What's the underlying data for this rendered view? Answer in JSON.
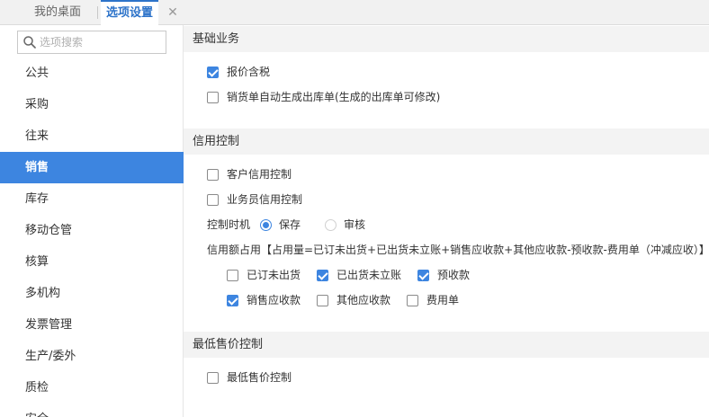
{
  "tabs": [
    {
      "label": "我的桌面"
    },
    {
      "label": "选项设置"
    }
  ],
  "tab_close_icon": "close-icon",
  "search": {
    "placeholder": "选项搜索",
    "value": ""
  },
  "sidebar": {
    "items": [
      {
        "label": "公共",
        "active": false
      },
      {
        "label": "采购",
        "active": false
      },
      {
        "label": "往来",
        "active": false
      },
      {
        "label": "销售",
        "active": true
      },
      {
        "label": "库存",
        "active": false
      },
      {
        "label": "移动仓管",
        "active": false
      },
      {
        "label": "核算",
        "active": false
      },
      {
        "label": "多机构",
        "active": false
      },
      {
        "label": "发票管理",
        "active": false
      },
      {
        "label": "生产/委外",
        "active": false
      },
      {
        "label": "质检",
        "active": false
      },
      {
        "label": "安全",
        "active": false
      }
    ]
  },
  "sections": {
    "basic": {
      "title": "基础业务",
      "options": [
        {
          "label": "报价含税",
          "checked": true
        },
        {
          "label": "销货单自动生成出库单(生成的出库单可修改)",
          "checked": false
        }
      ]
    },
    "credit": {
      "title": "信用控制",
      "options": [
        {
          "label": "客户信用控制",
          "checked": false
        },
        {
          "label": "业务员信用控制",
          "checked": false
        }
      ],
      "timing_label": "控制时机",
      "timing_options": [
        {
          "label": "保存",
          "checked": true
        },
        {
          "label": "审核",
          "checked": false
        }
      ],
      "usage_label": "信用额占用【占用量=已订未出货+已出货未立账+销售应收款+其他应收款-预收款-费用单（冲减应收）】",
      "usage_options": [
        {
          "label": "已订未出货",
          "checked": false
        },
        {
          "label": "已出货未立账",
          "checked": true
        },
        {
          "label": "预收款",
          "checked": true
        },
        {
          "label": "销售应收款",
          "checked": true
        },
        {
          "label": "其他应收款",
          "checked": false
        },
        {
          "label": "费用单",
          "checked": false
        }
      ]
    },
    "min_price": {
      "title": "最低售价控制",
      "options": [
        {
          "label": "最低售价控制",
          "checked": false
        }
      ]
    }
  },
  "colors": {
    "accent": "#3d85e0",
    "tab_active": "#2d73c9",
    "section_bg": "#f3f3f3"
  }
}
